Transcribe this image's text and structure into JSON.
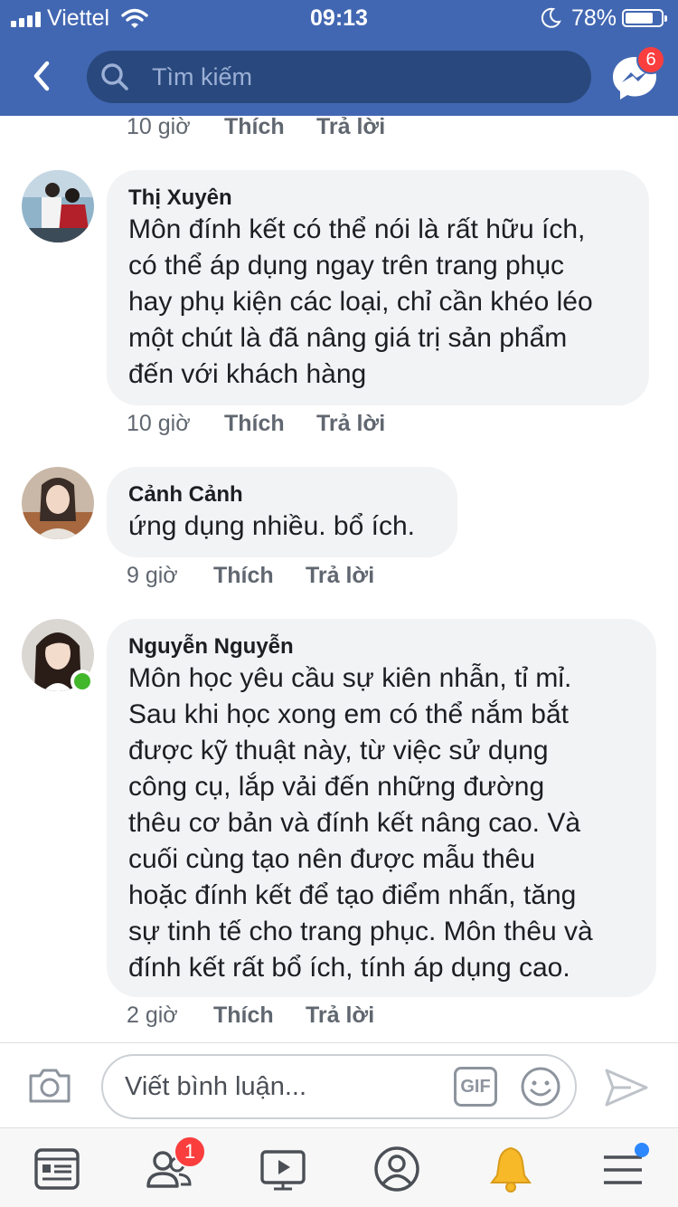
{
  "status_bar": {
    "carrier": "Viettel",
    "time": "09:13",
    "battery": "78%",
    "battery_level": 0.78
  },
  "header": {
    "search_placeholder": "Tìm kiếm",
    "messenger_badge": "6"
  },
  "top_actions": {
    "time": "10 giờ",
    "like": "Thích",
    "reply": "Trả lời"
  },
  "comments": [
    {
      "author": "Thị Xuyên",
      "text": "Môn đính kết có thể nói là rất hữu ích,\ncó thể áp dụng ngay trên trang phục\nhay phụ kiện các loại, chỉ cần khéo léo\nmột chút là đã nâng giá trị sản phẩm\nđến với khách hàng",
      "time": "10 giờ",
      "like": "Thích",
      "reply": "Trả lời"
    },
    {
      "author": "Cảnh Cảnh",
      "text": "ứng dụng nhiều. bổ ích.",
      "time": "9 giờ",
      "like": "Thích",
      "reply": "Trả lời"
    },
    {
      "author": "Nguyễn Nguyễn",
      "text": "Môn học yêu cầu sự kiên nhẫn, tỉ mỉ.\nSau khi học xong em có thể nắm bắt\nđược kỹ thuật này, từ việc sử dụng\ncông cụ, lắp vải đến những đường\nthêu cơ bản và đính kết nâng cao. Và\ncuối cùng tạo nên được mẫu thêu\nhoặc đính kết để tạo điểm nhấn, tăng\nsự tinh tế cho trang phục. Môn thêu và\nđính kết rất bổ ích, tính áp dụng cao.",
      "time": "2 giờ",
      "like": "Thích",
      "reply": "Trả lời"
    }
  ],
  "composer": {
    "placeholder": "Viết bình luận...",
    "gif_label": "GIF"
  },
  "tabbar": {
    "friends_badge": "1"
  },
  "colors": {
    "brand": "#4267b2",
    "bubble": "#f2f3f5",
    "badge": "#fa3e3e",
    "online": "#42b72a"
  }
}
